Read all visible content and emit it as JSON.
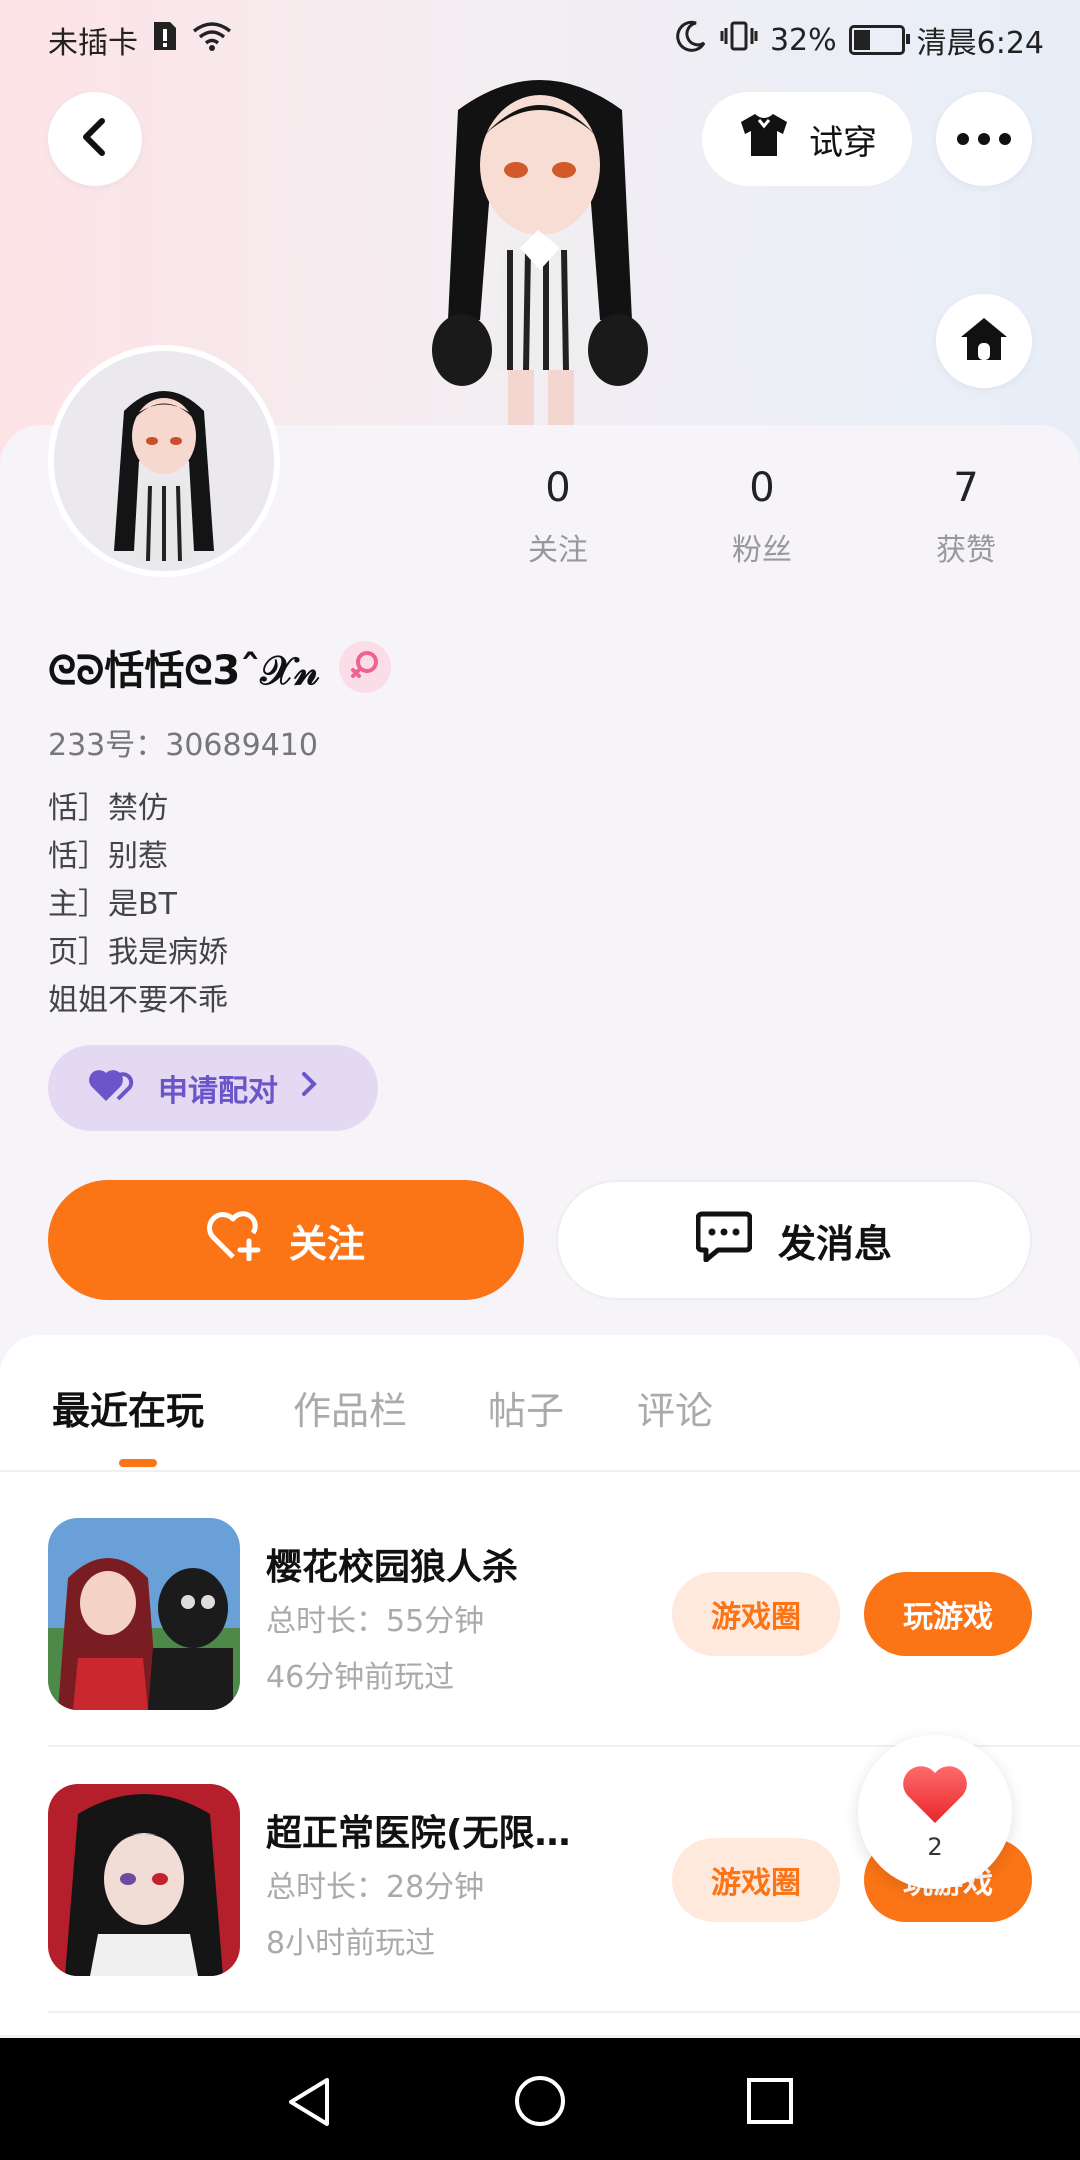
{
  "status_bar": {
    "carrier": "未插卡",
    "battery_text": "32%",
    "battery_level": 0.32,
    "time": "清晨6:24",
    "icons": [
      "sim-alert-icon",
      "wifi-icon",
      "moon-icon",
      "vibrate-icon",
      "battery-icon"
    ]
  },
  "header": {
    "tryon_label": "试穿",
    "icons": [
      "back-icon",
      "shirt-icon",
      "more-icon",
      "home-icon"
    ]
  },
  "stats": [
    {
      "value": "0",
      "label": "关注"
    },
    {
      "value": "0",
      "label": "粉丝"
    },
    {
      "value": "7",
      "label": "获赞"
    }
  ],
  "profile": {
    "nickname": "ᘓᘐ恬恬ᘓ3ˆ𝒳𝓃",
    "uid": "233号：30689410",
    "bio": [
      "恬］禁仿",
      "恬］别惹",
      "主］是BT",
      "页］我是病娇",
      "姐姐不要不乖"
    ],
    "pair_label": "申请配对"
  },
  "actions": {
    "follow_label": "关注",
    "message_label": "发消息"
  },
  "tabs": [
    "最近在玩",
    "作品栏",
    "帖子",
    "评论"
  ],
  "active_tab": "最近在玩",
  "games": [
    {
      "title": "樱花校园狼人杀",
      "duration": "总时长：55分钟",
      "last_played": "46分钟前玩过",
      "circle_label": "游戏圈",
      "play_label": "玩游戏"
    },
    {
      "title": "超正常医院(无限…",
      "duration": "总时长：28分钟",
      "last_played": "8小时前玩过",
      "circle_label": "游戏圈",
      "play_label": "玩游戏"
    }
  ],
  "floating_like": {
    "count": "2"
  },
  "colors": {
    "accent": "#fb7415",
    "accent_light": "#ffe9dd",
    "pair_bg": "#e3d9f3",
    "pair_text": "#6b55c8"
  }
}
